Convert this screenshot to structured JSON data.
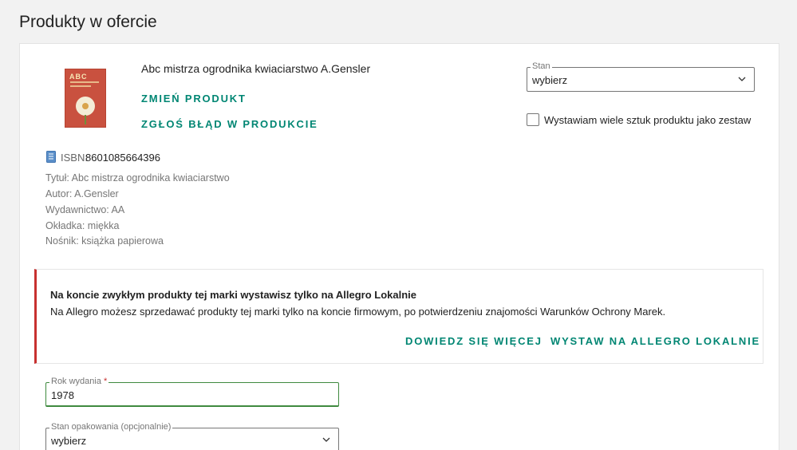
{
  "section": {
    "title": "Produkty w ofercie"
  },
  "product": {
    "title": "Abc mistrza ogrodnika kwiaciarstwo A.Gensler",
    "change_label": "ZMIEŃ PRODUKT",
    "report_label": "ZGŁOŚ BŁĄD W PRODUKCIE",
    "thumbnail_text": "ABC"
  },
  "condition": {
    "legend": "Stan",
    "value": "wybierz"
  },
  "set_option": {
    "label": "Wystawiam wiele sztuk produktu jako zestaw",
    "checked": false
  },
  "isbn": {
    "label": "ISBN:",
    "value": "8601085664396"
  },
  "specs": [
    "Tytuł: Abc mistrza ogrodnika kwiaciarstwo",
    "Autor: A.Gensler",
    "Wydawnictwo: AA",
    "Okładka: miękka",
    "Nośnik: książka papierowa"
  ],
  "alert": {
    "title": "Na koncie zwykłym produkty tej marki wystawisz tylko na Allegro Lokalnie",
    "text": "Na Allegro możesz sprzedawać produkty tej marki tylko na koncie firmowym, po potwierdzeniu znajomości Warunków Ochrony Marek.",
    "learn_more": "DOWIEDZ SIĘ WIĘCEJ",
    "list_local": "WYSTAW NA ALLEGRO LOKALNIE",
    "accent_color": "#c7302f"
  },
  "year": {
    "legend": "Rok wydania",
    "required_mark": "*",
    "value": "1978"
  },
  "packaging": {
    "legend": "Stan opakowania (opcjonalnie)",
    "value": "wybierz"
  },
  "colors": {
    "link": "#008673",
    "alert": "#c7302f",
    "focus_border": "#3f8a3f"
  }
}
